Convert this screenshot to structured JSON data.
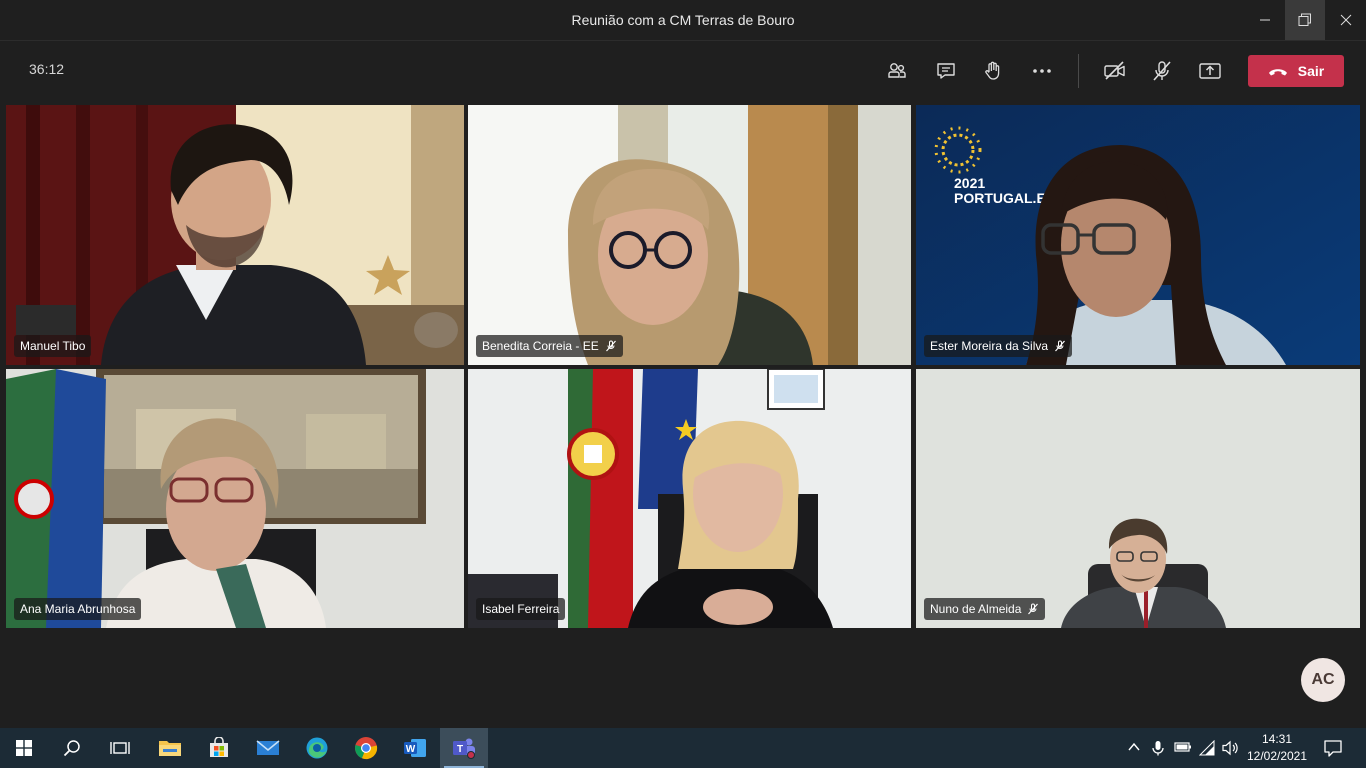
{
  "window": {
    "title": "Reunião com a CM Terras de Bouro"
  },
  "toolbar": {
    "timer": "36:12",
    "buttons": [
      "participants-icon",
      "chat-icon",
      "raise-hand-icon",
      "more-options-icon",
      "camera-off-icon",
      "mic-off-icon",
      "share-screen-icon"
    ],
    "leave_label": "Sair"
  },
  "participants": [
    {
      "name": "Manuel Tibo",
      "muted": false
    },
    {
      "name": "Benedita Correia - EE",
      "muted": true
    },
    {
      "name": "Ester Moreira da Silva",
      "muted": true
    },
    {
      "name": "Ana Maria Abrunhosa",
      "muted": false
    },
    {
      "name": "Isabel Ferreira",
      "muted": false
    },
    {
      "name": "Nuno de Almeida",
      "muted": true
    }
  ],
  "background_text": {
    "year": "2021",
    "site": "PORTUGAL.EU"
  },
  "self_avatar": {
    "initials": "AC"
  },
  "taskbar": {
    "time": "14:31",
    "date": "12/02/2021"
  }
}
